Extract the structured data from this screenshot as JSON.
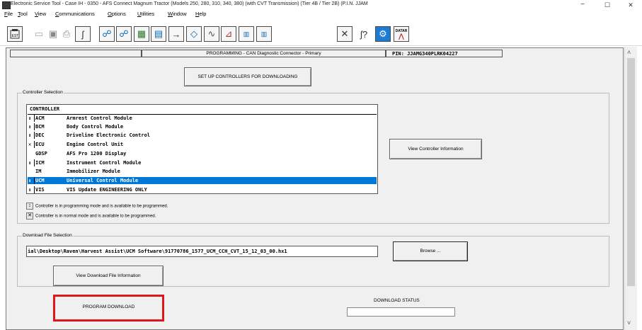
{
  "window": {
    "title": "Electronic Service Tool - Case IH - 0350 - AFS Connect Magnum Tractor (Models 250, 280, 310, 340, 380) (with CVT Transmission) (Tier 4B / Tier 2B) (P.I.N. JJAM",
    "minimize": "−",
    "maximize": "☐",
    "close": "✕"
  },
  "menu": {
    "items": [
      "File",
      "Tool",
      "View",
      "Communications",
      "Options",
      "Utilities",
      "Window",
      "Help"
    ],
    "accel": [
      "F",
      "T",
      "V",
      "C",
      "O",
      "U",
      "W",
      "H"
    ]
  },
  "toolbar": {
    "icons": [
      "est-icon",
      "dock-icon",
      "save-icon",
      "print-icon",
      "probe-icon",
      "network-icon",
      "network-config-icon",
      "module-icon",
      "grid-icon",
      "flow-icon",
      "connect-icon",
      "wave-icon",
      "gauge-icon",
      "binary-icon",
      "binary-download-icon",
      "tools-icon",
      "probe-help-icon",
      "settings-icon",
      "datar-icon"
    ],
    "datar_label": "DATAR"
  },
  "header": {
    "title": "PROGRAMMING  - CAN Diagnostic Connector - Primary",
    "pin": "PIN: JJAMG340PLRK04227"
  },
  "setup_button": "SET UP CONTROLLERS FOR DOWNLOADING",
  "controller_selection": {
    "legend": "Controller Selection",
    "header": "CONTROLLER",
    "rows": [
      {
        "sym": "↕",
        "code": "ACM",
        "name": "Armrest Control Module",
        "selected": false
      },
      {
        "sym": "↕",
        "code": "BCM",
        "name": "Body Control Module",
        "selected": false
      },
      {
        "sym": "↕",
        "code": "DEC",
        "name": "Driveline Electronic Control",
        "selected": false
      },
      {
        "sym": "✕",
        "code": "ECU",
        "name": "Engine Control Unit",
        "selected": false
      },
      {
        "sym": "",
        "code": "GDSP",
        "name": "AFS Pro 1200 Display",
        "selected": false
      },
      {
        "sym": "↕",
        "code": "ICM",
        "name": "Instrument Control Module",
        "selected": false
      },
      {
        "sym": "",
        "code": "IM",
        "name": "Immobilizer Module",
        "selected": false
      },
      {
        "sym": "↕",
        "code": "UCM",
        "name": "Universal Control Module",
        "selected": true
      },
      {
        "sym": "↕",
        "code": "VIS",
        "name": "VIS Update ENGINEERING ONLY",
        "selected": false
      }
    ],
    "view_info_button": "View Controller Information",
    "legend_programming_sym": "↕",
    "legend_programming": "Controller is in programming mode and is available to be programmed.",
    "legend_normal_sym": "✕",
    "legend_normal": "Controller is in normal mode and is available to be programmed."
  },
  "download_file": {
    "legend": "Download File Selection",
    "path": "ial\\Desktop\\Raven\\Harvest Assist\\UCM Software\\91770786_1577_UCM_CCH_CVT_15_12_03_00.hx1",
    "browse_button": "Browse ...",
    "view_info_button": "View Download File Information"
  },
  "program_button": "PROGRAM DOWNLOAD",
  "download_status_label": "DOWNLOAD STATUS",
  "colors": {
    "selection": "#0078d7",
    "highlight_box": "#e0161f"
  }
}
